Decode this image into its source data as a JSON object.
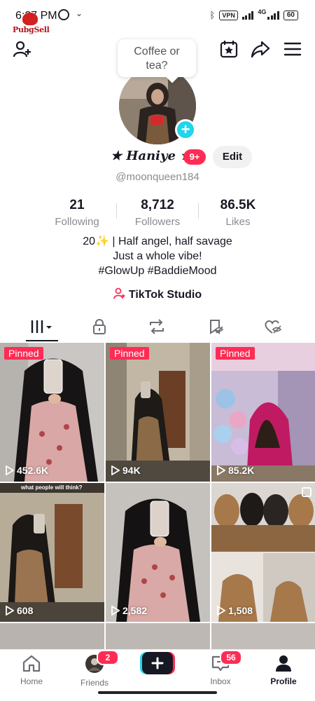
{
  "status_bar": {
    "time": "6:27 PM",
    "vpn": "VPN",
    "network": "4G",
    "battery": "60"
  },
  "watermark": {
    "text": "PubgSell"
  },
  "bubble": {
    "text_line1": "Coffee or",
    "text_line2": "tea?"
  },
  "profile": {
    "display_name": "★ Haniye ★",
    "name_badge": "9+",
    "edit_label": "Edit",
    "username": "@moonqueen184"
  },
  "stats": [
    {
      "value": "21",
      "label": "Following"
    },
    {
      "value": "8,712",
      "label": "Followers"
    },
    {
      "value": "86.5K",
      "label": "Likes"
    }
  ],
  "bio": {
    "line1": "20✨ | Half angel, half savage",
    "line2": "Just a whole vibe!",
    "line3": "#GlowUp #BaddieMood"
  },
  "studio": {
    "label": "TikTok Studio"
  },
  "tabs": [
    "videos",
    "private",
    "reposts",
    "favorites",
    "liked"
  ],
  "videos": [
    {
      "pinned": "Pinned",
      "views": "452.6K"
    },
    {
      "pinned": "Pinned",
      "views": "94K"
    },
    {
      "pinned": "Pinned",
      "views": "85.2K"
    },
    {
      "pinned": "",
      "views": "608",
      "caption": "what people will think?"
    },
    {
      "pinned": "",
      "views": "2,582"
    },
    {
      "pinned": "",
      "views": "1,508"
    }
  ],
  "nav": {
    "home": "Home",
    "friends": "Friends",
    "friends_badge": "2",
    "inbox": "Inbox",
    "inbox_badge": "56",
    "profile": "Profile"
  },
  "colors": {
    "accent": "#fe2c55",
    "cyan": "#20d5ec",
    "text": "#161823",
    "muted": "#8a8b91"
  }
}
